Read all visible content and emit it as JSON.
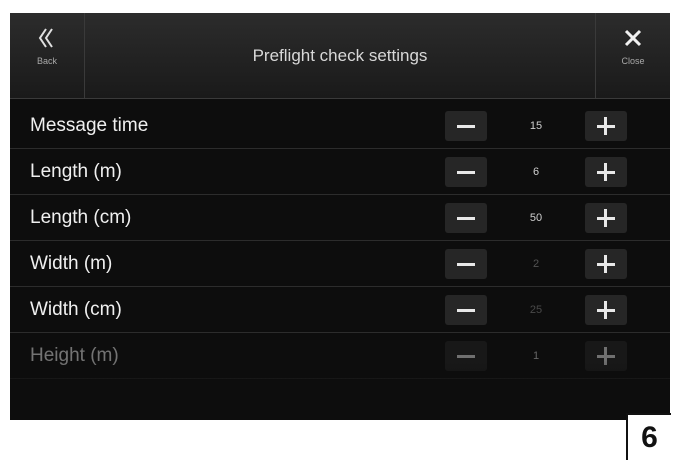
{
  "header": {
    "title": "Preflight check settings",
    "back_label": "Back",
    "close_label": "Close"
  },
  "icons": {
    "back": "double-chevron-left-icon",
    "close": "close-x-icon",
    "minus": "minus-icon",
    "plus": "plus-icon"
  },
  "settings": [
    {
      "label": "Message time",
      "value": "15"
    },
    {
      "label": "Length (m)",
      "value": "6"
    },
    {
      "label": "Length (cm)",
      "value": "50"
    },
    {
      "label": "Width (m)",
      "value": "2"
    },
    {
      "label": "Width (cm)",
      "value": "25"
    },
    {
      "label": "Height (m)",
      "value": "1"
    }
  ],
  "page_number": "6"
}
